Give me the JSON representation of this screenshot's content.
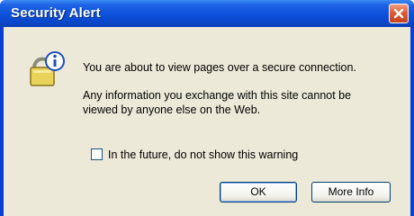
{
  "window": {
    "title": "Security Alert",
    "close_label": "Close"
  },
  "dialog": {
    "icon": "security-info-icon",
    "message_primary": "You are about to view pages over a secure connection.",
    "message_secondary": "Any information you exchange with this site cannot be viewed by anyone else on the Web.",
    "checkbox": {
      "label": "In the future, do not show this warning",
      "checked": false
    },
    "buttons": {
      "ok_label": "OK",
      "more_info_label": "More Info"
    }
  },
  "colors": {
    "titlebar": "#0c4fd9",
    "client_background": "#ece9d8",
    "close_button": "#e05a33"
  }
}
